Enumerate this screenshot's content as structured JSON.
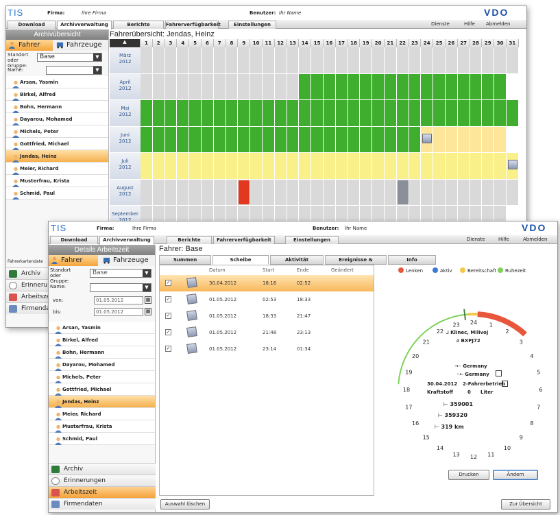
{
  "app": {
    "logo": "TIS",
    "brand": "VDO",
    "firma_label": "Firma:",
    "firma_value": "Ihre Firma",
    "benutzer_label": "Benutzer:",
    "benutzer_value": "Ihr Name",
    "menu": [
      "Dienste",
      "Hilfe",
      "Abmelden"
    ]
  },
  "nav_tabs": [
    "Download",
    "Archivverwaltung",
    "Berichte",
    "Fahrerverfügbarkeit",
    "Einstellungen"
  ],
  "back_window": {
    "sidebar_title": "Archivübersicht",
    "toggle": [
      "Fahrer",
      "Fahrzeuge"
    ],
    "standort_label": "Standort oder Gruppe:",
    "standort_value": "Base",
    "name_label": "Name:",
    "drivers": [
      "Arsan, Yasmin",
      "Birkel, Alfred",
      "Bohn, Hermann",
      "Dayarou, Mohamed",
      "Michels, Peter",
      "Gottfried, Michael",
      "Jendas, Heinz",
      "Meier, Richard",
      "Musterfrau, Krista",
      "Schmid, Paul"
    ],
    "selected_driver": "Jendas, Heinz",
    "partial_label": "Fahrerkartendate",
    "nav": [
      "Archiv",
      "Erinnerun",
      "Arbeitsze",
      "Firmenda"
    ],
    "calendar_title": "Fahrerübersicht: Jendas, Heinz",
    "days": [
      "1",
      "2",
      "3",
      "4",
      "5",
      "6",
      "7",
      "8",
      "9",
      "10",
      "11",
      "12",
      "13",
      "14",
      "15",
      "16",
      "17",
      "18",
      "19",
      "20",
      "21",
      "22",
      "23",
      "24",
      "25",
      "26",
      "27",
      "28",
      "29",
      "30",
      "31"
    ],
    "months": [
      {
        "name": "März",
        "year": "2012",
        "days_in_month": 31,
        "segments": [
          {
            "from": 1,
            "to": 31,
            "status": "none"
          }
        ],
        "markers": []
      },
      {
        "name": "April",
        "year": "2012",
        "days_in_month": 30,
        "segments": [
          {
            "from": 1,
            "to": 13,
            "status": "none"
          },
          {
            "from": 14,
            "to": 30,
            "status": "complete"
          }
        ],
        "markers": []
      },
      {
        "name": "Mai",
        "year": "2012",
        "days_in_month": 31,
        "segments": [
          {
            "from": 1,
            "to": 31,
            "status": "complete"
          }
        ],
        "markers": []
      },
      {
        "name": "Juni",
        "year": "2012",
        "days_in_month": 30,
        "segments": [
          {
            "from": 1,
            "to": 23,
            "status": "complete"
          },
          {
            "from": 24,
            "to": 30,
            "status": "partial"
          }
        ],
        "markers": [
          {
            "day": 24,
            "kind": "disc"
          }
        ]
      },
      {
        "name": "Juli",
        "year": "2012",
        "days_in_month": 31,
        "segments": [
          {
            "from": 1,
            "to": 31,
            "status": "pending"
          }
        ],
        "markers": [
          {
            "day": 31,
            "kind": "disc"
          }
        ]
      },
      {
        "name": "August",
        "year": "2012",
        "days_in_month": 31,
        "segments": [
          {
            "from": 1,
            "to": 31,
            "status": "none"
          }
        ],
        "markers": [
          {
            "day": 9,
            "kind": "alert"
          },
          {
            "day": 22,
            "kind": "info"
          }
        ]
      },
      {
        "name": "September",
        "year": "2012",
        "days_in_month": 30,
        "segments": [
          {
            "from": 1,
            "to": 30,
            "status": "none"
          }
        ],
        "markers": []
      }
    ],
    "status_colors": {
      "none": "#d9d9d9",
      "complete": "#3fae2f",
      "partial": "#fde59a",
      "pending": "#faf08a"
    }
  },
  "front_window": {
    "sidebar_title": "Details Arbeitszeit",
    "toggle": [
      "Fahrer",
      "Fahrzeuge"
    ],
    "standort_label": "Standort oder Gruppe:",
    "standort_value": "Base",
    "name_label": "Name:",
    "von_label": "von:",
    "von_value": "01.05.2012",
    "bis_label": "bis:",
    "bis_value": "01.05.2012",
    "drivers": [
      "Arsan, Yasmin",
      "Birkel, Alfred",
      "Bohn, Hermann",
      "Dayarou, Mohamed",
      "Michels, Peter",
      "Gottfried, Michael",
      "Jendas, Heinz",
      "Meier, Richard",
      "Musterfrau, Krista",
      "Schmid, Paul"
    ],
    "selected_driver": "Jendas, Heinz",
    "nav": [
      "Archiv",
      "Erinnerungen",
      "Arbeitszeit",
      "Firmendaten"
    ],
    "selected_nav": "Arbeitszeit",
    "page_title": "Fahrer: Base",
    "subtabs": [
      "Summen",
      "Scheibe",
      "Aktivität",
      "Ereignisse & Störungen",
      "Info"
    ],
    "active_subtab": "Scheibe",
    "table_headers": [
      "Datum",
      "Start",
      "Ende",
      "Geändert"
    ],
    "rows": [
      {
        "checked": "✓",
        "date": "30.04.2012",
        "start": "18:16",
        "end": "02:52",
        "selected": true
      },
      {
        "checked": "✓",
        "date": "01.05.2012",
        "start": "02:53",
        "end": "18:33",
        "selected": false
      },
      {
        "checked": "✓",
        "date": "01.05.2012",
        "start": "18:33",
        "end": "21:47",
        "selected": false
      },
      {
        "checked": "✓",
        "date": "01.05.2012",
        "start": "21:48",
        "end": "23:13",
        "selected": false
      },
      {
        "checked": "✓",
        "date": "01.05.2012",
        "start": "23:14",
        "end": "01:34",
        "selected": false
      }
    ],
    "legend": [
      {
        "label": "Lenken",
        "icon": "steering-wheel-icon",
        "color": "#e8563c"
      },
      {
        "label": "Aktiv",
        "icon": "hammer-icon",
        "color": "#3a7bd5"
      },
      {
        "label": "Bereitschaft",
        "icon": "standby-icon",
        "color": "#f2c94c"
      },
      {
        "label": "Ruhezeit",
        "icon": "bed-icon",
        "color": "#7fd15a"
      }
    ],
    "disc": {
      "driver": "Klinec, Milivoj",
      "plate": "BXPJ72",
      "country_start": "Germany",
      "country_end": "Germany",
      "date": "30.04.2012",
      "mode": "2-Fahrerbetrieb",
      "fuel_label": "Kraftstoff",
      "fuel_value": "0",
      "fuel_unit": "Liter",
      "odo_start": "359001",
      "odo_end": "359320",
      "distance": "319",
      "distance_unit": "km",
      "hours": [
        "24",
        "1",
        "2",
        "3",
        "4",
        "5",
        "6",
        "7",
        "8",
        "9",
        "10",
        "11",
        "12",
        "13",
        "14",
        "15",
        "16",
        "17",
        "18",
        "19",
        "20",
        "21",
        "22",
        "23"
      ]
    },
    "buttons": {
      "print": "Drucken",
      "change": "Ändern",
      "clear": "Auswahl löschen",
      "overview": "Zur Übersicht"
    }
  }
}
